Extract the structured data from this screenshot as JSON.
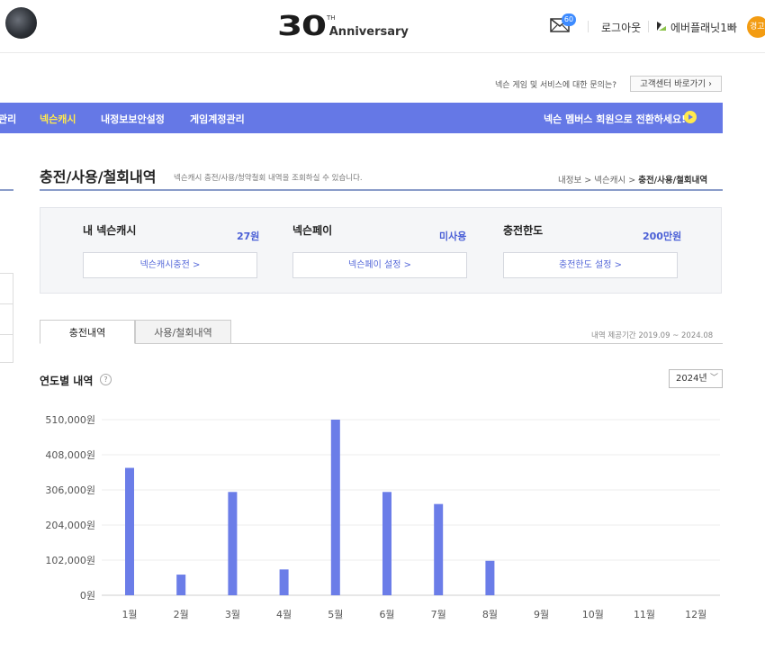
{
  "header": {
    "logo_number": "30",
    "logo_suffix": "TH",
    "logo_word": "Anniversary",
    "mail_count": "60",
    "logout_label": "로그아웃",
    "user_name": "에버플래닛1빠",
    "warn_badge": "경고"
  },
  "inquiry": {
    "text": "넥슨 게임 및 서비스에 대한 문의는?",
    "button_label": "고객센터 바로가기 ›"
  },
  "nav": {
    "items": [
      {
        "label": "관리",
        "active": false
      },
      {
        "label": "넥슨캐시",
        "active": true
      },
      {
        "label": "내정보보안설정",
        "active": false
      },
      {
        "label": "게임계정관리",
        "active": false
      }
    ],
    "promo_label": "넥슨 멤버스 회원으로 전환하세요!"
  },
  "page": {
    "title": "충전/사용/철회내역",
    "description": "넥슨캐시 충전/사용/청약철회 내역을 조회하실 수 있습니다.",
    "breadcrumb": [
      "내정보",
      "넥슨캐시",
      "충전/사용/철회내역"
    ]
  },
  "summary": [
    {
      "label": "내 넥슨캐시",
      "value": "27원",
      "button": "넥슨캐시충전 >"
    },
    {
      "label": "넥슨페이",
      "value": "미사용",
      "button": "넥슨페이 설정 >"
    },
    {
      "label": "충전한도",
      "value": "200만원",
      "button": "충전한도 설정 >"
    }
  ],
  "tabs": [
    {
      "label": "충전내역",
      "active": true
    },
    {
      "label": "사용/철회내역",
      "active": false
    }
  ],
  "period_text": "내역 제공기간 2019.09 ~ 2024.08",
  "yearly": {
    "title": "연도별 내역",
    "help_icon": "question-icon",
    "selected_year": "2024년"
  },
  "colors": {
    "nav_bg": "#6578e6",
    "accent": "#4a5fd6",
    "bar": "#6b7de8",
    "nav_active": "#ffe94d"
  },
  "chart_data": {
    "type": "bar",
    "categories": [
      "1월",
      "2월",
      "3월",
      "4월",
      "5월",
      "6월",
      "7월",
      "8월",
      "9월",
      "10월",
      "11월",
      "12월"
    ],
    "values": [
      370000,
      60000,
      300000,
      75000,
      510000,
      300000,
      265000,
      100000,
      0,
      0,
      0,
      0
    ],
    "ylim": [
      0,
      510000
    ],
    "yticks": [
      0,
      102000,
      204000,
      306000,
      408000,
      510000
    ],
    "ytick_labels": [
      "0원",
      "102,000원",
      "204,000원",
      "306,000원",
      "408,000원",
      "510,000원"
    ],
    "grid": true
  }
}
